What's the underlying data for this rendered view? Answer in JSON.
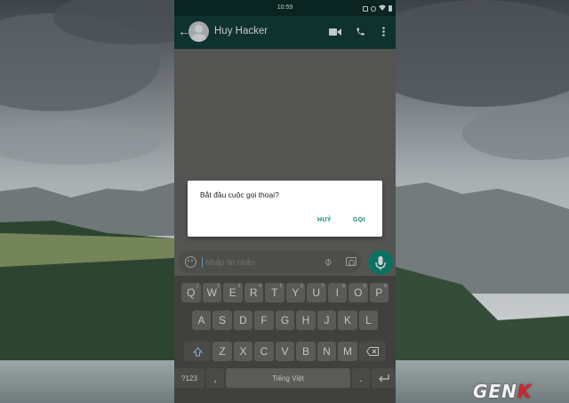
{
  "status_bar": {
    "time": "10:59",
    "icons": [
      "data-saver-icon",
      "alarm-icon",
      "wifi-icon",
      "battery-icon"
    ]
  },
  "app_bar": {
    "contact_name": "Huy Hacker",
    "icons": [
      "back-arrow-icon",
      "video-call-icon",
      "phone-call-icon",
      "more-vert-icon"
    ]
  },
  "composer": {
    "placeholder": "Nhập tin nhắn",
    "icons": [
      "emoji-icon",
      "attach-icon",
      "camera-icon",
      "mic-icon"
    ]
  },
  "dialog": {
    "message": "Bắt đầu cuộc gọi thoại?",
    "cancel_label": "HUỶ",
    "call_label": "GỌI"
  },
  "keyboard": {
    "row1": [
      {
        "key": "Q",
        "hint": "1"
      },
      {
        "key": "W",
        "hint": "2"
      },
      {
        "key": "E",
        "hint": "3"
      },
      {
        "key": "R",
        "hint": "4"
      },
      {
        "key": "T",
        "hint": "5"
      },
      {
        "key": "Y",
        "hint": "6"
      },
      {
        "key": "U",
        "hint": "7"
      },
      {
        "key": "I",
        "hint": "8"
      },
      {
        "key": "O",
        "hint": "9"
      },
      {
        "key": "P",
        "hint": "0"
      }
    ],
    "row2": [
      "A",
      "S",
      "D",
      "F",
      "G",
      "H",
      "J",
      "K",
      "L"
    ],
    "row3": [
      "Z",
      "X",
      "C",
      "V",
      "B",
      "N",
      "M"
    ],
    "symbols_label": "?123",
    "comma_label": ",",
    "space_label": "Tiếng Việt",
    "period_label": "."
  },
  "watermark": {
    "text_main": "GEN",
    "text_accent": "K"
  },
  "colors": {
    "header_dark": "#0b2d29",
    "header": "#123d38",
    "accent": "#0f8a78",
    "dialog_button": "#16897a"
  }
}
